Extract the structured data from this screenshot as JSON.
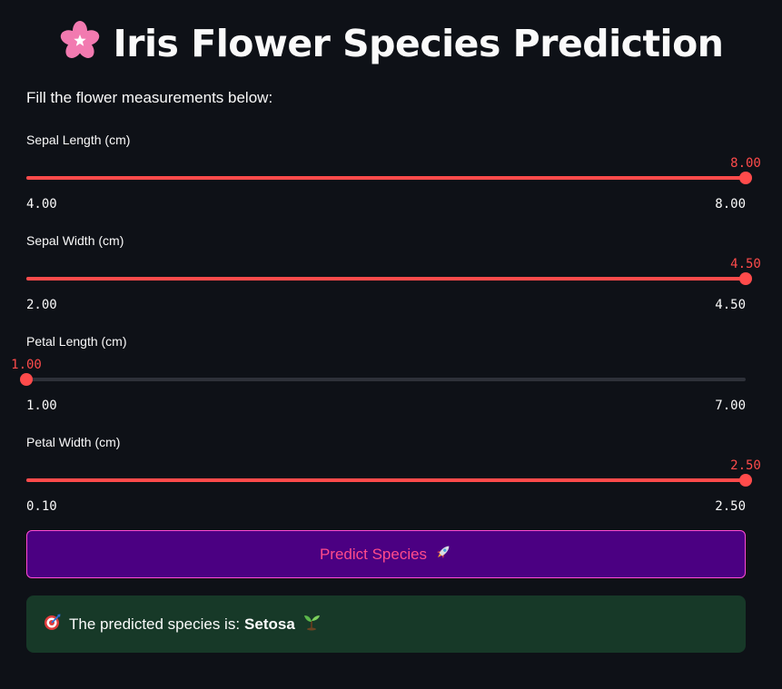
{
  "header": {
    "title": "Iris Flower Species Prediction",
    "icon": "cherry-blossom-icon"
  },
  "intro_text": "Fill the flower measurements below:",
  "sliders": [
    {
      "label": "Sepal Length (cm)",
      "value": "8.00",
      "min": "4.00",
      "max": "8.00",
      "fraction": 1.0
    },
    {
      "label": "Sepal Width (cm)",
      "value": "4.50",
      "min": "2.00",
      "max": "4.50",
      "fraction": 1.0
    },
    {
      "label": "Petal Length (cm)",
      "value": "1.00",
      "min": "1.00",
      "max": "7.00",
      "fraction": 0.0
    },
    {
      "label": "Petal Width (cm)",
      "value": "2.50",
      "min": "0.10",
      "max": "2.50",
      "fraction": 1.0
    }
  ],
  "predict_button": {
    "label": "Predict Species",
    "icon": "rocket-icon"
  },
  "result": {
    "prefix": "The predicted species is:",
    "species": "Setosa",
    "lead_icon": "target-icon",
    "trail_icon": "sprout-icon"
  },
  "colors": {
    "background": "#0e1117",
    "accent": "#ff4b4b",
    "button_bg": "#4b0082",
    "button_text": "#ff4b8b",
    "success_bg": "#173928"
  }
}
